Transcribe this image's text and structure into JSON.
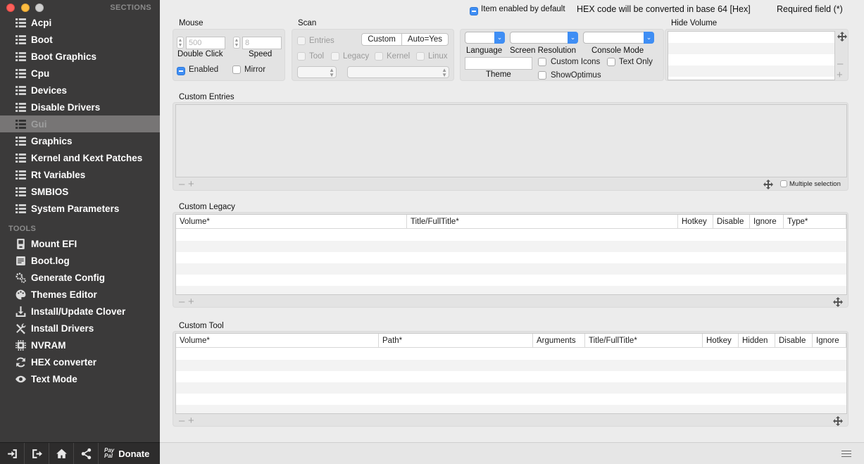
{
  "sidebar": {
    "sections_heading": "SECTIONS",
    "sections": [
      {
        "label": "Acpi",
        "icon": "list-icon"
      },
      {
        "label": "Boot",
        "icon": "list-icon"
      },
      {
        "label": "Boot Graphics",
        "icon": "list-icon"
      },
      {
        "label": "Cpu",
        "icon": "list-icon"
      },
      {
        "label": "Devices",
        "icon": "list-icon"
      },
      {
        "label": "Disable Drivers",
        "icon": "list-icon"
      },
      {
        "label": "Gui",
        "icon": "list-icon",
        "selected": true
      },
      {
        "label": "Graphics",
        "icon": "list-icon"
      },
      {
        "label": "Kernel and Kext Patches",
        "icon": "list-icon"
      },
      {
        "label": "Rt Variables",
        "icon": "list-icon"
      },
      {
        "label": "SMBIOS",
        "icon": "list-icon"
      },
      {
        "label": "System Parameters",
        "icon": "list-icon"
      }
    ],
    "tools_heading": "TOOLS",
    "tools": [
      {
        "label": "Mount EFI",
        "icon": "disk-icon"
      },
      {
        "label": "Boot.log",
        "icon": "log-icon"
      },
      {
        "label": "Generate Config",
        "icon": "gears-icon"
      },
      {
        "label": "Themes Editor",
        "icon": "palette-icon"
      },
      {
        "label": "Install/Update Clover",
        "icon": "download-icon"
      },
      {
        "label": "Install Drivers",
        "icon": "tools-icon"
      },
      {
        "label": "NVRAM",
        "icon": "chip-icon"
      },
      {
        "label": "HEX converter",
        "icon": "refresh-icon"
      },
      {
        "label": "Text Mode",
        "icon": "eye-icon"
      }
    ],
    "bottom": {
      "paypal_line1": "Pay",
      "paypal_line2": "Pal",
      "donate_label": "Donate"
    }
  },
  "status": {
    "enabled_default": "Item enabled by default",
    "hex_note": "HEX code will be converted in base 64 [Hex]",
    "required_note": "Required field (*)"
  },
  "mouse": {
    "title": "Mouse",
    "double_click_value": "500",
    "double_click_label": "Double Click",
    "speed_value": "8",
    "speed_label": "Speed",
    "enabled_label": "Enabled",
    "mirror_label": "Mirror"
  },
  "scan": {
    "title": "Scan",
    "entries_label": "Entries",
    "custom_label": "Custom",
    "auto_label": "Auto=Yes",
    "tool_label": "Tool",
    "legacy_label": "Legacy",
    "kernel_label": "Kernel",
    "linux_label": "Linux"
  },
  "display": {
    "language_label": "Language",
    "screen_resolution_label": "Screen Resolution",
    "console_mode_label": "Console Mode",
    "theme_label": "Theme",
    "custom_icons_label": "Custom Icons",
    "text_only_label": "Text Only",
    "show_optimus_label": "ShowOptimus"
  },
  "hide_volume": {
    "title": "Hide Volume"
  },
  "custom_entries": {
    "title": "Custom Entries",
    "multiple_selection_label": "Multiple selection"
  },
  "custom_legacy": {
    "title": "Custom Legacy",
    "columns": [
      "Volume*",
      "Title/FullTitle*",
      "Hotkey",
      "Disable",
      "Ignore",
      "Type*"
    ]
  },
  "custom_tool": {
    "title": "Custom Tool",
    "columns": [
      "Volume*",
      "Path*",
      "Arguments",
      "Title/FullTitle*",
      "Hotkey",
      "Hidden",
      "Disable",
      "Ignore"
    ]
  },
  "colors": {
    "sidebar_bg": "#3b3a3a",
    "selected_bg": "#777575",
    "accent": "#3f8ef4"
  }
}
